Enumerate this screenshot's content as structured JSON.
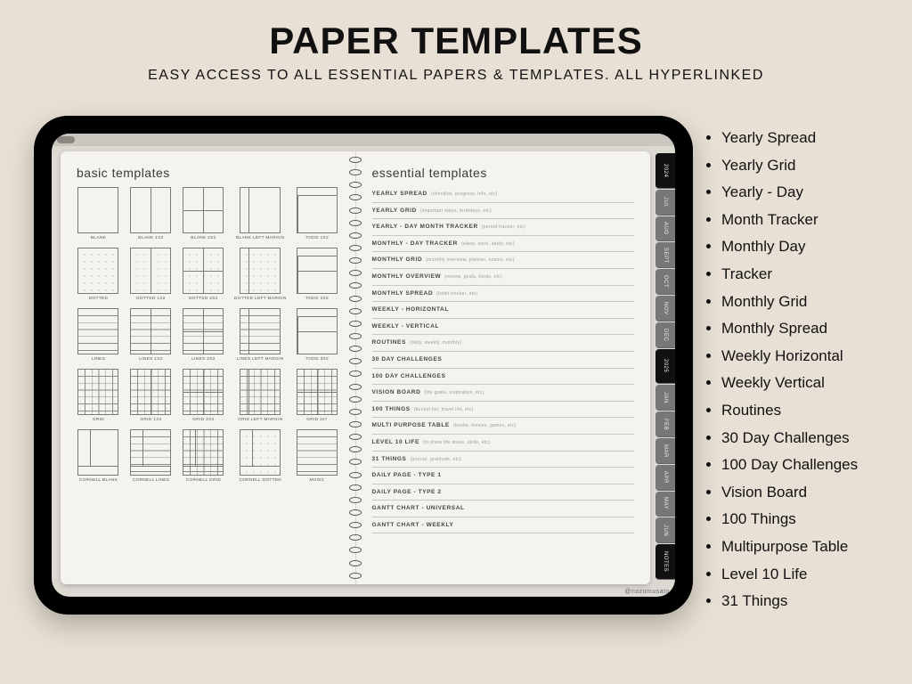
{
  "header": {
    "title": "PAPER TEMPLATES",
    "subtitle": "EASY ACCESS TO ALL ESSENTIAL PAPERS & TEMPLATES. ALL HYPERLINKED"
  },
  "bullet_list": [
    "Yearly Spread",
    "Yearly Grid",
    "Yearly - Day",
    "Month Tracker",
    "Monthly Day",
    "Tracker",
    "Monthly Grid",
    "Monthly Spread",
    "Weekly Horizontal",
    "Weekly Vertical",
    "Routines",
    "30 Day Challenges",
    "100 Day Challenges",
    "Vision Board",
    "100 Things",
    "Multipurpose Table",
    "Level 10 Life",
    "31 Things"
  ],
  "side_tabs": [
    "2024",
    "JUL",
    "AUG",
    "SEPT",
    "OCT",
    "NOV",
    "DEC",
    "2025",
    "JAN",
    "FEB",
    "MAR",
    "APR",
    "MAY",
    "JUN",
    "NOTES"
  ],
  "watermark": "@nozomusato",
  "left_page": {
    "heading": "basic templates",
    "thumbs": [
      {
        "label": "BLANK",
        "cls": ""
      },
      {
        "label": "BLANK 1X2",
        "cls": "v-split"
      },
      {
        "label": "BLANK 2X2",
        "cls": "quad"
      },
      {
        "label": "BLANK LEFT MARGIN",
        "cls": "lmargin"
      },
      {
        "label": "TODO 1X2",
        "cls": "v-split tophdr"
      },
      {
        "label": "DOTTED",
        "cls": "dotted"
      },
      {
        "label": "DOTTED 1X2",
        "cls": "dotted v-split"
      },
      {
        "label": "DOTTED 2X2",
        "cls": "dotted quad"
      },
      {
        "label": "DOTTED LEFT MARGIN",
        "cls": "dotted lmargin"
      },
      {
        "label": "TODO 2X2",
        "cls": "quad tophdr"
      },
      {
        "label": "LINES",
        "cls": "lines"
      },
      {
        "label": "LINES 1X2",
        "cls": "lines v-split"
      },
      {
        "label": "LINES 2X2",
        "cls": "lines quad"
      },
      {
        "label": "LINES LEFT MARGIN",
        "cls": "lines lmargin"
      },
      {
        "label": "TODO 3X2",
        "cls": "quad tophdr"
      },
      {
        "label": "GRID",
        "cls": "grid4"
      },
      {
        "label": "GRID 1X2",
        "cls": "grid4 v-split"
      },
      {
        "label": "GRID 2X2",
        "cls": "grid4 quad"
      },
      {
        "label": "GRID LEFT MARGIN",
        "cls": "grid4 lmargin"
      },
      {
        "label": "GRID 2x7",
        "cls": "grid4 quad"
      },
      {
        "label": "CORNELL BLANK",
        "cls": "cornell"
      },
      {
        "label": "CORNELL LINES",
        "cls": "cornell lines"
      },
      {
        "label": "CORNELL GRID",
        "cls": "cornell grid4"
      },
      {
        "label": "CORNELL DOTTED",
        "cls": "cornell dotted"
      },
      {
        "label": "MUSIC",
        "cls": "lines"
      }
    ]
  },
  "right_page": {
    "heading": "essential templates",
    "items": [
      {
        "title": "YEARLY SPREAD",
        "desc": "(checklist, progress, info, etc)"
      },
      {
        "title": "YEARLY GRID",
        "desc": "(important dates, birthdays, etc)"
      },
      {
        "title": "YEARLY - DAY MONTH TRACKER",
        "desc": "(period tracker, etc)"
      },
      {
        "title": "MONTHLY - DAY TRACKER",
        "desc": "(sleep, work, study, etc)"
      },
      {
        "title": "MONTHLY GRID",
        "desc": "(monthly overview, planner, exams, etc)"
      },
      {
        "title": "MONTHLY OVERVIEW",
        "desc": "(review, goals, foods, etc)"
      },
      {
        "title": "MONTHLY SPREAD",
        "desc": "(habit tracker, etc)"
      },
      {
        "title": "WEEKLY - HORIZONTAL",
        "desc": ""
      },
      {
        "title": "WEEKLY - VERTICAL",
        "desc": ""
      },
      {
        "title": "ROUTINES",
        "desc": "(daily, weekly, monthly)"
      },
      {
        "title": "30 DAY CHALLENGES",
        "desc": ""
      },
      {
        "title": "100 DAY CHALLENGES",
        "desc": ""
      },
      {
        "title": "VISION BOARD",
        "desc": "(life goals, inspiration, etc)"
      },
      {
        "title": "100 THINGS",
        "desc": "(bucket list, travel list, etc)"
      },
      {
        "title": "MULTI PURPOSE TABLE",
        "desc": "(books, movies, games, etc)"
      },
      {
        "title": "LEVEL 10 LIFE",
        "desc": "(to know life areas, skills, etc)"
      },
      {
        "title": "31 THINGS",
        "desc": "(journal, gratitude, etc)"
      },
      {
        "title": "DAILY PAGE - TYPE 1",
        "desc": ""
      },
      {
        "title": "DAILY PAGE - TYPE 2",
        "desc": ""
      },
      {
        "title": "GANTT CHART - UNIVERSAL",
        "desc": ""
      },
      {
        "title": "GANTT CHART - WEEKLY",
        "desc": ""
      }
    ]
  }
}
